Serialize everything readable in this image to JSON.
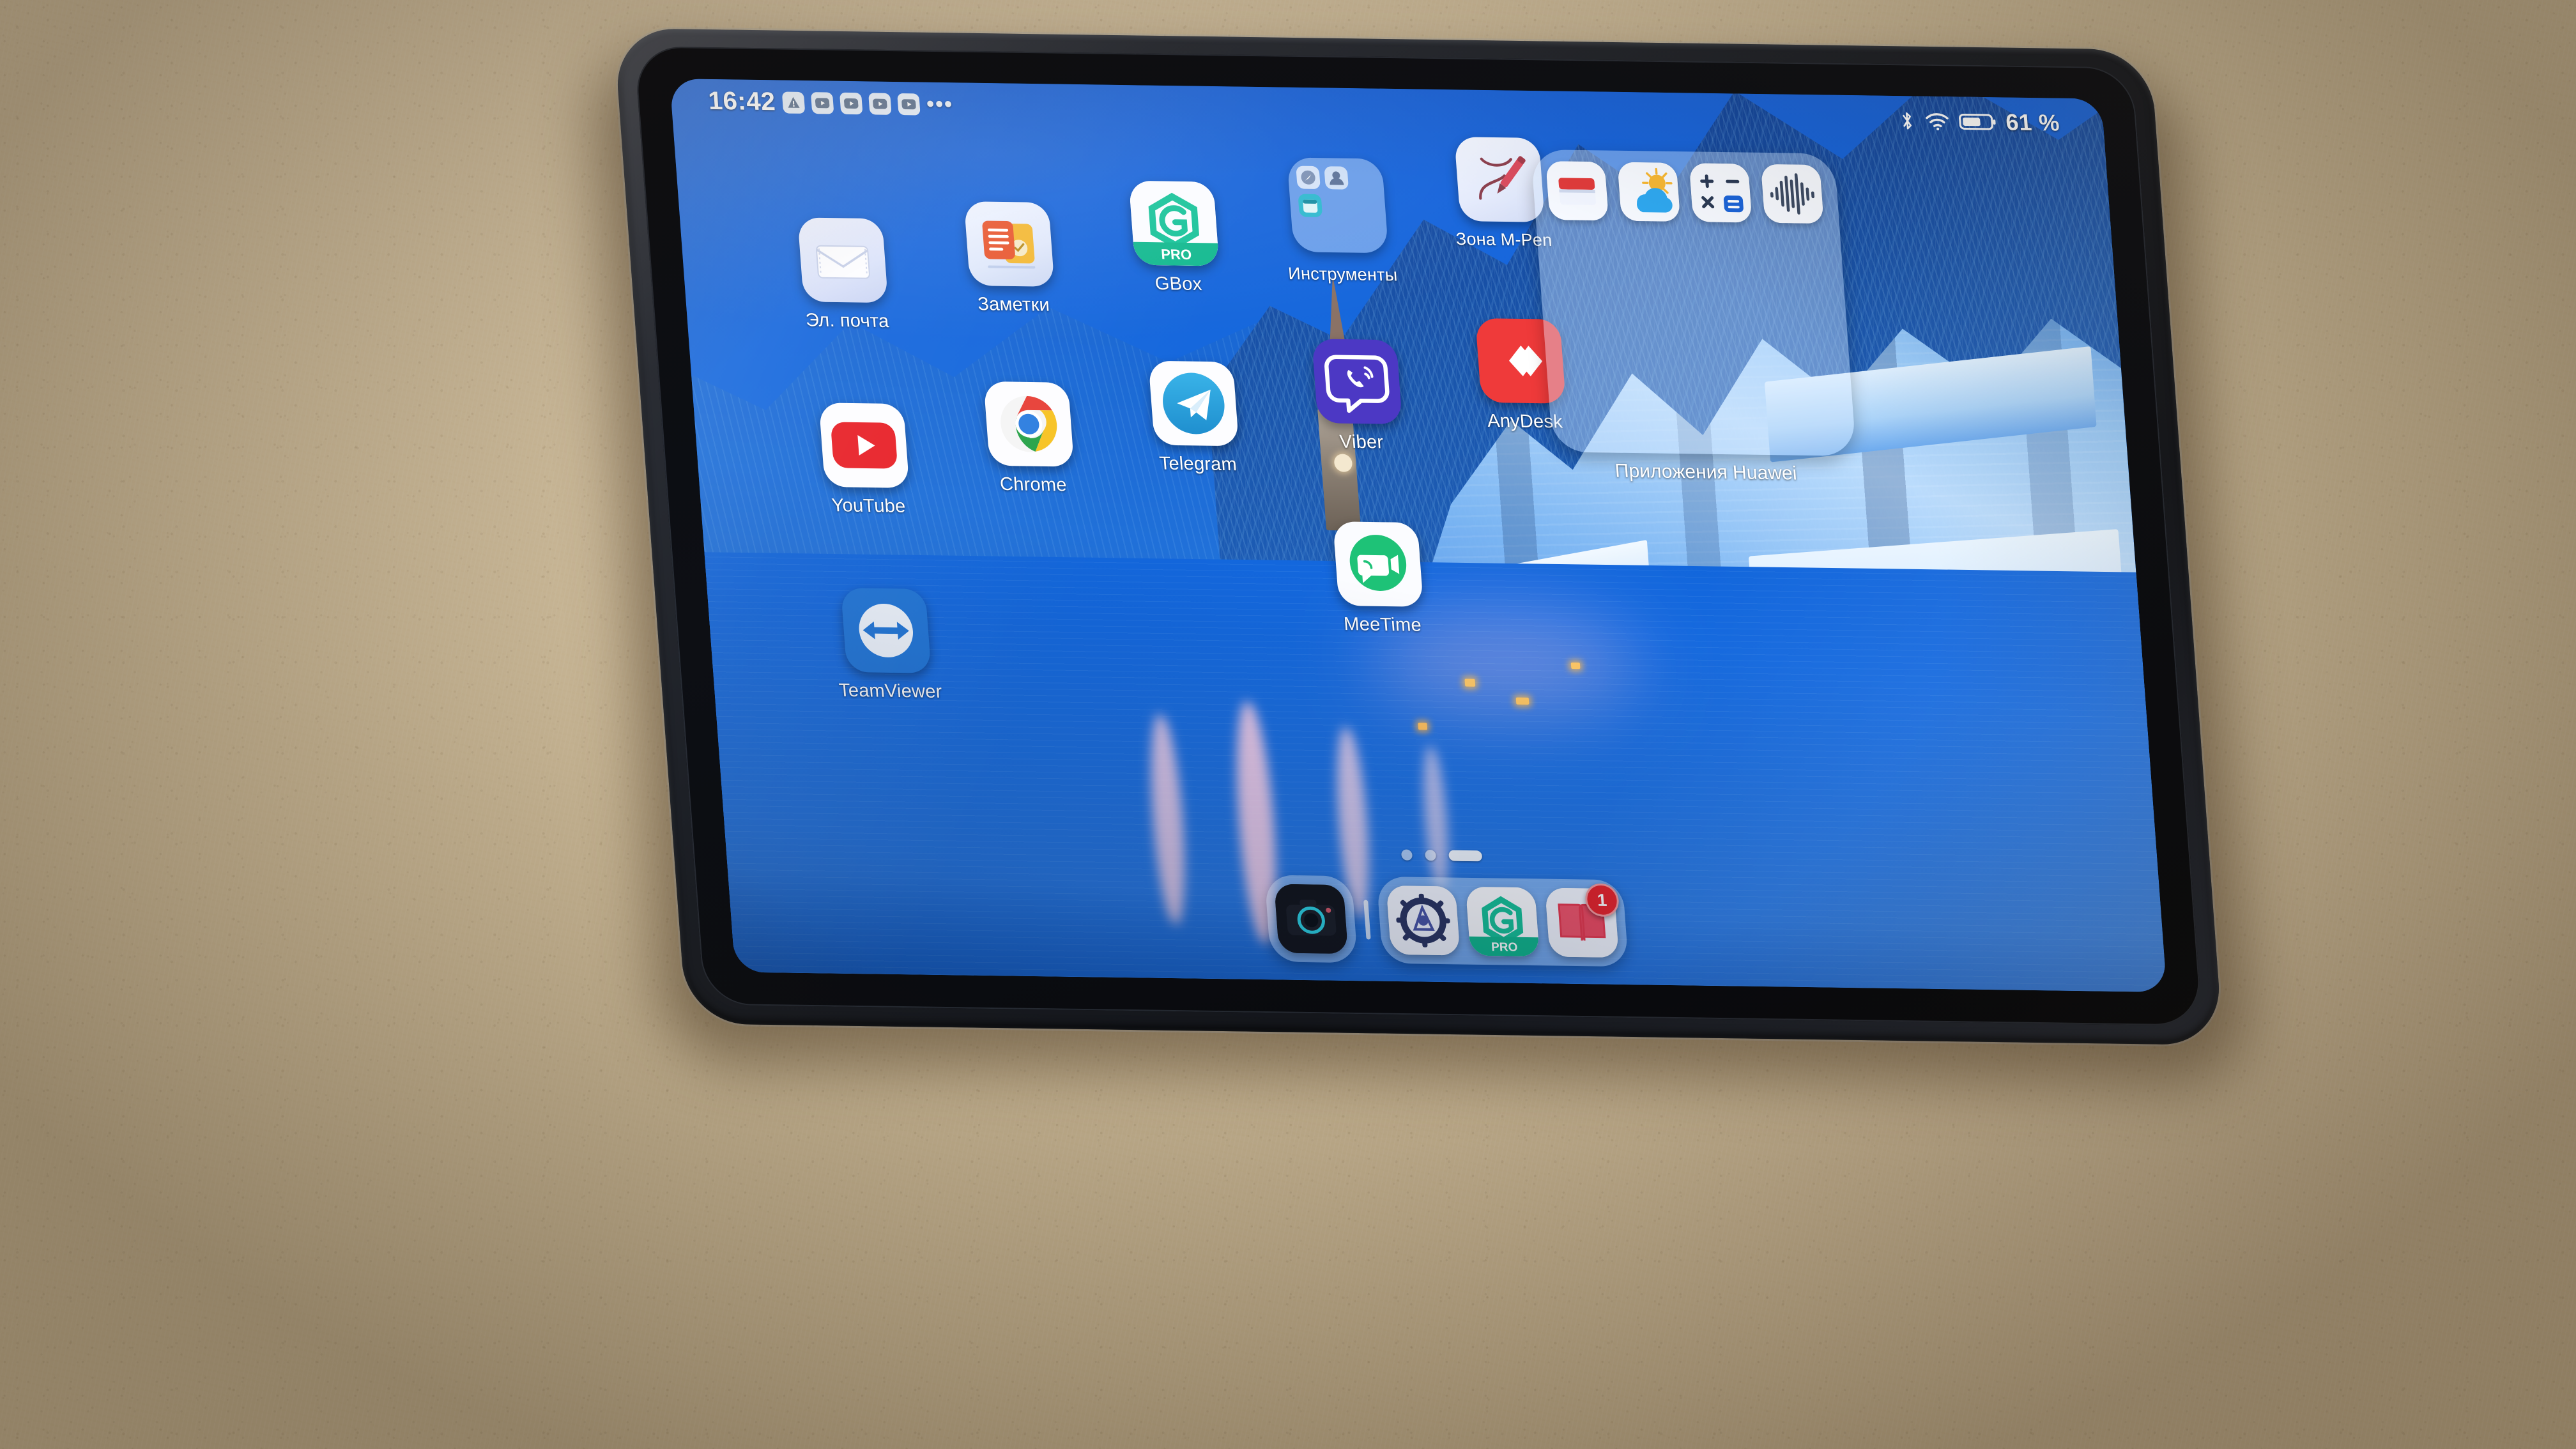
{
  "device": {
    "kind": "tablet",
    "brand": "Huawei",
    "surface": "cardboard-desk",
    "frame_color": "#1a1d23"
  },
  "wallpaper": {
    "scene": "Hallstatt winter village at dusk",
    "primary_color": "#1668dd",
    "accent_light": "#ffbe5c"
  },
  "status_bar": {
    "time": "16:42",
    "left_icons": [
      "alert-icon",
      "youtube-notification-icon",
      "youtube-notification-icon",
      "youtube-notification-icon",
      "youtube-notification-icon"
    ],
    "overflow": "•••",
    "right_icons": [
      "bluetooth-icon",
      "wifi-icon",
      "battery-icon"
    ],
    "battery_percent": "61 %"
  },
  "home_screen": {
    "apps": [
      {
        "label": "Эл. почта",
        "icon": "email-icon",
        "col": 0,
        "row": 0
      },
      {
        "label": "Заметки",
        "icon": "notes-icon",
        "col": 1,
        "row": 0
      },
      {
        "label": "GBox",
        "icon": "gbox-icon",
        "col": 2,
        "row": 0
      },
      {
        "label": "Инструменты",
        "icon": "tools-folder-icon",
        "col": 3,
        "row": 0
      },
      {
        "label": "Зона M-Pen",
        "icon": "m-pen-icon",
        "col": 4,
        "row": 0
      },
      {
        "label": "YouTube",
        "icon": "youtube-icon",
        "col": 0,
        "row": 1
      },
      {
        "label": "Chrome",
        "icon": "chrome-icon",
        "col": 1,
        "row": 1
      },
      {
        "label": "Telegram",
        "icon": "telegram-icon",
        "col": 2,
        "row": 1
      },
      {
        "label": "Viber",
        "icon": "viber-icon",
        "col": 3,
        "row": 1
      },
      {
        "label": "AnyDesk",
        "icon": "anydesk-icon",
        "col": 4,
        "row": 1
      },
      {
        "label": "TeamViewer",
        "icon": "teamviewer-icon",
        "col": 0,
        "row": 2
      },
      {
        "label": "MeeTime",
        "icon": "meetime-icon",
        "col": 3,
        "row": 2
      }
    ],
    "tools_folder": {
      "label": "Инструменты",
      "mini_icons": [
        "compass-icon",
        "contacts-icon",
        "calendar-icon"
      ]
    },
    "huawei_folder": {
      "label": "Приложения Huawei",
      "mini_icons": [
        "appgallery-icon",
        "weather-icon",
        "calculator-icon",
        "recorder-icon"
      ]
    },
    "page_indicator": {
      "pages": 3,
      "active_index": 2
    },
    "dock": {
      "camera": {
        "label": "Camera",
        "icon": "camera-icon"
      },
      "separator": true,
      "items": [
        {
          "label": "Настройки",
          "icon": "settings-icon",
          "badge": ""
        },
        {
          "label": "GBox",
          "icon": "gbox-icon",
          "badge": ""
        },
        {
          "label": "Книги",
          "icon": "books-icon",
          "badge": "1"
        }
      ]
    }
  },
  "colors": {
    "youtube_red": "#e8232a",
    "telegram_blue": "#32a8e0",
    "viber_purple": "#4c38c4",
    "anydesk_red": "#ef3a3a",
    "gbox_teal": "#18c39a",
    "meetime_green": "#1ec277",
    "notes_orange": "#e8562e",
    "notes_yellow": "#f3ba35",
    "badge_red": "#e8232a",
    "desk_tan": "#c4b291"
  }
}
